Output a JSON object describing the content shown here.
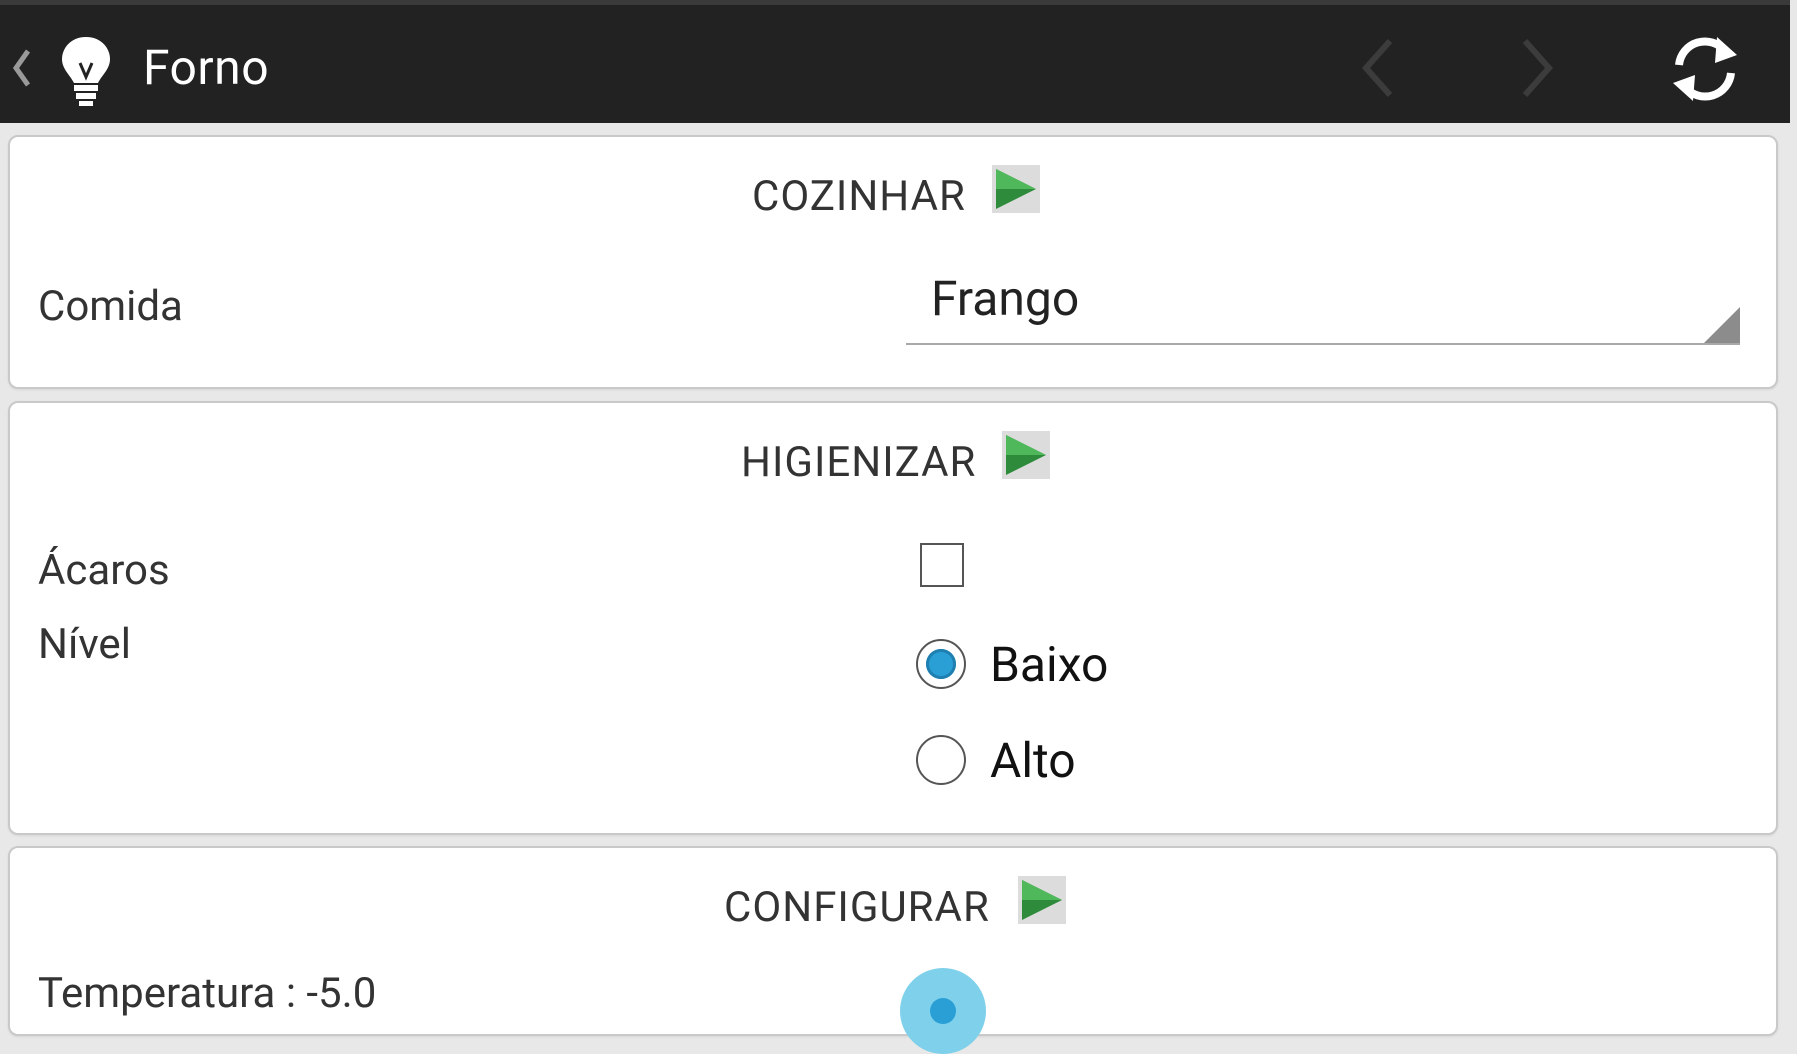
{
  "appbar": {
    "title": "Forno",
    "up_icon": "chevron-left-icon",
    "app_icon": "lightbulb-icon",
    "prev_icon": "chevron-left-icon",
    "next_icon": "chevron-right-icon",
    "refresh_icon": "refresh-icon"
  },
  "sections": {
    "cozinhar": {
      "title": "COZINHAR",
      "comida_label": "Comida",
      "comida_value": "Frango"
    },
    "higienizar": {
      "title": "HIGIENIZAR",
      "acaros_label": "Ácaros",
      "acaros_checked": false,
      "nivel_label": "Nível",
      "nivel_options": [
        "Baixo",
        "Alto"
      ],
      "nivel_selected": "Baixo"
    },
    "configurar": {
      "title": "CONFIGURAR",
      "temperatura_label": "Temperatura : -5.0"
    }
  },
  "colors": {
    "appbar_bg": "#222222",
    "play_green": "#2e8b3c",
    "radio_accent": "#2a9fd6"
  }
}
